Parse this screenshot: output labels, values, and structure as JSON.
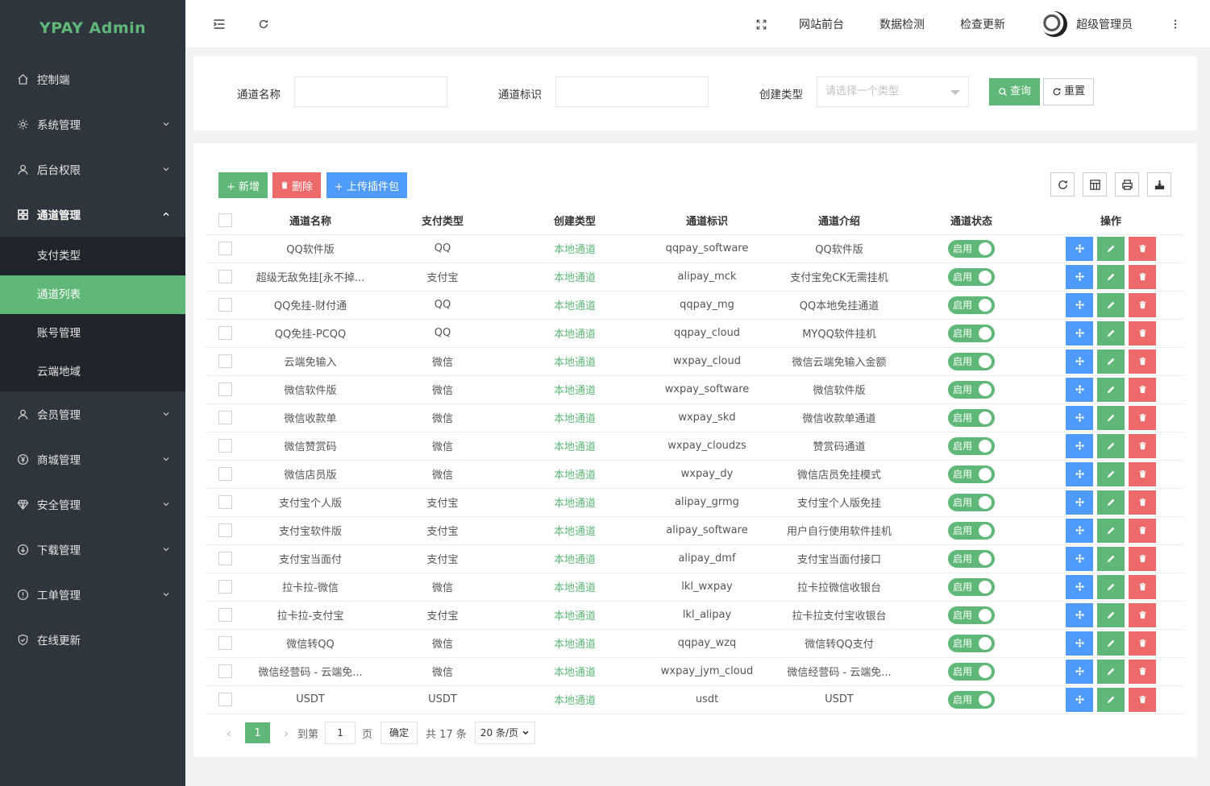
{
  "app": {
    "title": "YPAY Admin"
  },
  "sidebar": {
    "items": [
      {
        "label": "控制端",
        "icon": "home-icon"
      },
      {
        "label": "系统管理",
        "icon": "gear-icon"
      },
      {
        "label": "后台权限",
        "icon": "user-icon"
      },
      {
        "label": "通道管理",
        "icon": "grid-icon"
      },
      {
        "label": "会员管理",
        "icon": "user-icon"
      },
      {
        "label": "商城管理",
        "icon": "yen-icon"
      },
      {
        "label": "安全管理",
        "icon": "diamond-icon"
      },
      {
        "label": "下载管理",
        "icon": "download-icon"
      },
      {
        "label": "工单管理",
        "icon": "info-icon"
      },
      {
        "label": "在线更新",
        "icon": "shield-check-icon"
      }
    ],
    "submenu": [
      {
        "label": "支付类型"
      },
      {
        "label": "通道列表"
      },
      {
        "label": "账号管理"
      },
      {
        "label": "云端地域"
      }
    ]
  },
  "header": {
    "links": [
      "网站前台",
      "数据检测",
      "检查更新"
    ],
    "user": "超级管理员"
  },
  "search": {
    "name_label": "通道名称",
    "name_value": "",
    "mark_label": "通道标识",
    "mark_value": "",
    "type_label": "创建类型",
    "type_placeholder": "请选择一个类型",
    "query_label": "查询",
    "reset_label": "重置"
  },
  "toolbar": {
    "add_label": "+ 新增",
    "delete_label": "删除",
    "upload_label": "+ 上传插件包"
  },
  "table": {
    "headers": [
      "通道名称",
      "支付类型",
      "创建类型",
      "通道标识",
      "通道介绍",
      "通道状态",
      "操作"
    ],
    "status_label": "启用",
    "rows": [
      {
        "name": "QQ软件版",
        "pay": "QQ",
        "ctype": "本地通道",
        "mark": "qqpay_software",
        "intro": "QQ软件版"
      },
      {
        "name": "超级无敌免挂[永不掉...",
        "pay": "支付宝",
        "ctype": "本地通道",
        "mark": "alipay_mck",
        "intro": "支付宝免CK无需挂机"
      },
      {
        "name": "QQ免挂-财付通",
        "pay": "QQ",
        "ctype": "本地通道",
        "mark": "qqpay_mg",
        "intro": "QQ本地免挂通道"
      },
      {
        "name": "QQ免挂-PCQQ",
        "pay": "QQ",
        "ctype": "本地通道",
        "mark": "qqpay_cloud",
        "intro": "MYQQ软件挂机"
      },
      {
        "name": "云端免输入",
        "pay": "微信",
        "ctype": "本地通道",
        "mark": "wxpay_cloud",
        "intro": "微信云端免输入金额"
      },
      {
        "name": "微信软件版",
        "pay": "微信",
        "ctype": "本地通道",
        "mark": "wxpay_software",
        "intro": "微信软件版"
      },
      {
        "name": "微信收款单",
        "pay": "微信",
        "ctype": "本地通道",
        "mark": "wxpay_skd",
        "intro": "微信收款单通道"
      },
      {
        "name": "微信赞赏码",
        "pay": "微信",
        "ctype": "本地通道",
        "mark": "wxpay_cloudzs",
        "intro": "赞赏码通道"
      },
      {
        "name": "微信店员版",
        "pay": "微信",
        "ctype": "本地通道",
        "mark": "wxpay_dy",
        "intro": "微信店员免挂模式"
      },
      {
        "name": "支付宝个人版",
        "pay": "支付宝",
        "ctype": "本地通道",
        "mark": "alipay_grmg",
        "intro": "支付宝个人版免挂"
      },
      {
        "name": "支付宝软件版",
        "pay": "支付宝",
        "ctype": "本地通道",
        "mark": "alipay_software",
        "intro": "用户自行使用软件挂机"
      },
      {
        "name": "支付宝当面付",
        "pay": "支付宝",
        "ctype": "本地通道",
        "mark": "alipay_dmf",
        "intro": "支付宝当面付接口"
      },
      {
        "name": "拉卡拉-微信",
        "pay": "微信",
        "ctype": "本地通道",
        "mark": "lkl_wxpay",
        "intro": "拉卡拉微信收银台"
      },
      {
        "name": "拉卡拉-支付宝",
        "pay": "支付宝",
        "ctype": "本地通道",
        "mark": "lkl_alipay",
        "intro": "拉卡拉支付宝收银台"
      },
      {
        "name": "微信转QQ",
        "pay": "微信",
        "ctype": "本地通道",
        "mark": "qqpay_wzq",
        "intro": "微信转QQ支付"
      },
      {
        "name": "微信经营码 - 云端免...",
        "pay": "微信",
        "ctype": "本地通道",
        "mark": "wxpay_jym_cloud",
        "intro": "微信经营码 - 云端免..."
      },
      {
        "name": "USDT",
        "pay": "USDT",
        "ctype": "本地通道",
        "mark": "usdt",
        "intro": "USDT"
      }
    ]
  },
  "pager": {
    "current": "1",
    "goto_label": "到第",
    "goto_value": "1",
    "page_label": "页",
    "confirm_label": "确定",
    "total_label": "共 17 条",
    "size_label": "20 条/页"
  },
  "colors": {
    "accent": "#5fb878",
    "danger": "#ee6969",
    "primary": "#4f9bfc",
    "sidebar": "#2f353d"
  }
}
